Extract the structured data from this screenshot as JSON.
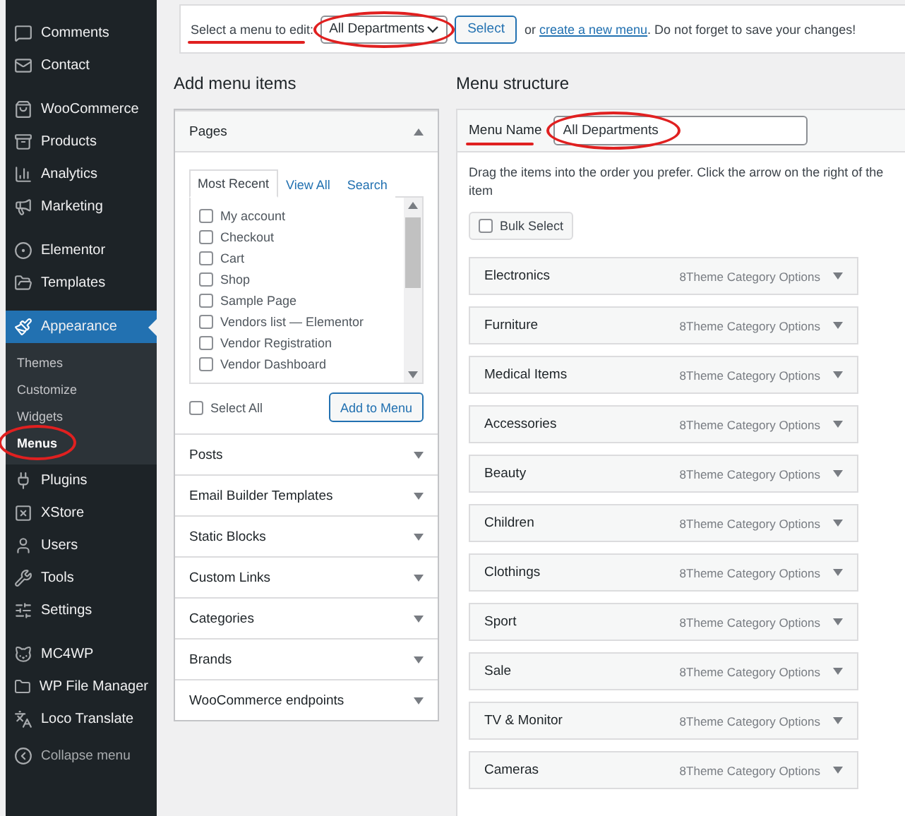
{
  "sidebar": {
    "groups": [
      [
        {
          "label": "Comments",
          "selected": false
        },
        {
          "label": "Contact",
          "selected": false
        }
      ],
      [
        {
          "label": "WooCommerce",
          "selected": false
        },
        {
          "label": "Products",
          "selected": false
        },
        {
          "label": "Analytics",
          "selected": false
        },
        {
          "label": "Marketing",
          "selected": false
        }
      ],
      [
        {
          "label": "Elementor",
          "selected": false
        },
        {
          "label": "Templates",
          "selected": false
        }
      ],
      [
        {
          "label": "Appearance",
          "selected": true,
          "children": [
            {
              "label": "Themes",
              "selected": false,
              "circled": false
            },
            {
              "label": "Customize",
              "selected": false,
              "circled": false
            },
            {
              "label": "Widgets",
              "selected": false,
              "circled": false
            },
            {
              "label": "Menus",
              "selected": true,
              "circled": true
            }
          ]
        },
        {
          "label": "Plugins",
          "selected": false
        },
        {
          "label": "XStore",
          "selected": false
        },
        {
          "label": "Users",
          "selected": false
        },
        {
          "label": "Tools",
          "selected": false
        },
        {
          "label": "Settings",
          "selected": false
        }
      ],
      [
        {
          "label": "MC4WP",
          "selected": false
        },
        {
          "label": "WP File Manager",
          "selected": false
        },
        {
          "label": "Loco Translate",
          "selected": false
        }
      ]
    ],
    "collapse": "Collapse menu"
  },
  "top_bar": {
    "label": "Select a menu to edit:",
    "label_underlined": true,
    "select_value": "All Departments",
    "select_circled": true,
    "button": "Select",
    "text_before_link": "or",
    "link": "create a new menu",
    "text_after_link": ". Do not forget to save your changes!"
  },
  "add_menu_items": {
    "title": "Add menu items",
    "sections": [
      {
        "title": "Pages",
        "expanded": true,
        "tabs": [
          {
            "label": "Most Recent",
            "selected": true
          },
          {
            "label": "View All",
            "selected": false
          },
          {
            "label": "Search",
            "selected": false
          }
        ],
        "items": [
          {
            "label": "My account",
            "checked": false
          },
          {
            "label": "Checkout",
            "checked": false
          },
          {
            "label": "Cart",
            "checked": false
          },
          {
            "label": "Shop",
            "checked": false
          },
          {
            "label": "Sample Page",
            "checked": false
          },
          {
            "label": "Vendors list — Elementor",
            "checked": false
          },
          {
            "label": "Vendor Registration",
            "checked": false
          },
          {
            "label": "Vendor Dashboard",
            "checked": false
          }
        ],
        "select_all": {
          "label": "Select All",
          "checked": false
        },
        "button": "Add to Menu"
      },
      {
        "title": "Posts",
        "expanded": false
      },
      {
        "title": "Email Builder Templates",
        "expanded": false
      },
      {
        "title": "Static Blocks",
        "expanded": false
      },
      {
        "title": "Custom Links",
        "expanded": false
      },
      {
        "title": "Categories",
        "expanded": false
      },
      {
        "title": "Brands",
        "expanded": false
      },
      {
        "title": "WooCommerce endpoints",
        "expanded": false
      }
    ]
  },
  "menu_structure": {
    "title": "Menu structure",
    "name_label": "Menu Name",
    "name_label_underlined": true,
    "name_value": "All Departments",
    "name_circled": true,
    "instructions": "Drag the items into the order you prefer. Click the arrow on the right of the item",
    "bulk_select": {
      "label": "Bulk Select",
      "checked": false
    },
    "items": [
      {
        "label": "Electronics",
        "type_label": "8Theme Category Options"
      },
      {
        "label": "Furniture",
        "type_label": "8Theme Category Options"
      },
      {
        "label": "Medical Items",
        "type_label": "8Theme Category Options"
      },
      {
        "label": "Accessories",
        "type_label": "8Theme Category Options"
      },
      {
        "label": "Beauty",
        "type_label": "8Theme Category Options"
      },
      {
        "label": "Children",
        "type_label": "8Theme Category Options"
      },
      {
        "label": "Clothings",
        "type_label": "8Theme Category Options"
      },
      {
        "label": "Sport",
        "type_label": "8Theme Category Options"
      },
      {
        "label": "Sale",
        "type_label": "8Theme Category Options"
      },
      {
        "label": "TV & Monitor",
        "type_label": "8Theme Category Options"
      },
      {
        "label": "Cameras",
        "type_label": "8Theme Category Options"
      }
    ]
  }
}
